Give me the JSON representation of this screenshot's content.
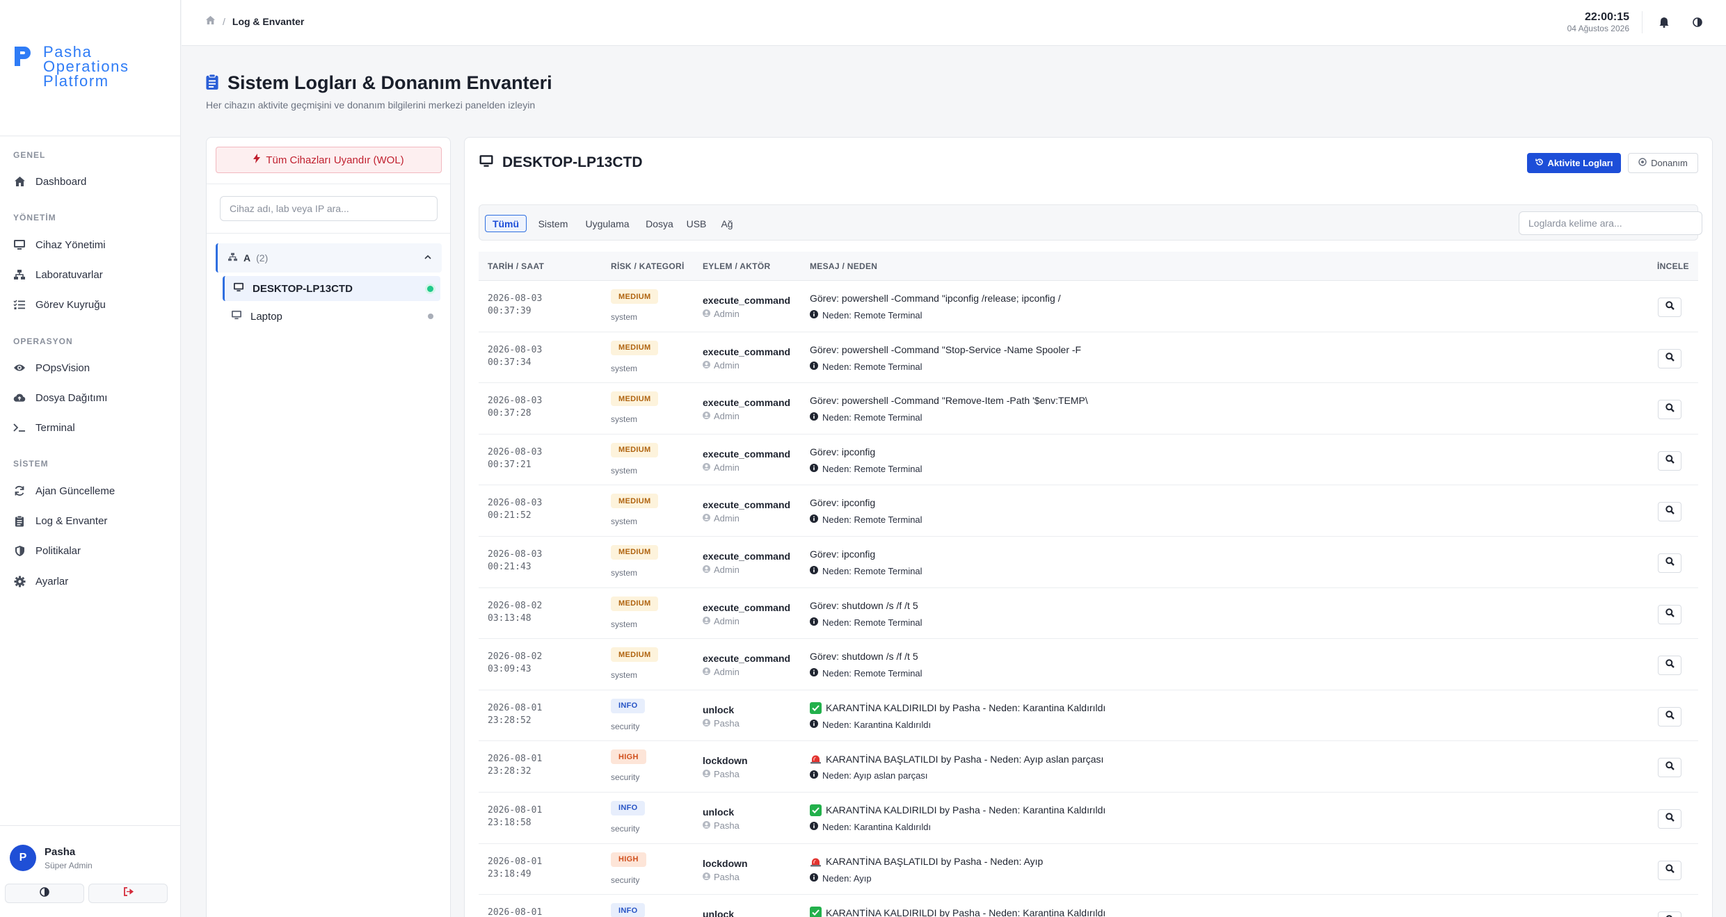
{
  "brand": {
    "line1": "Pasha",
    "line2": "Operations",
    "line3": "Platform"
  },
  "sidebar": {
    "sections": [
      {
        "label": "GENEL",
        "items": [
          {
            "label": "Dashboard",
            "icon": "home-icon"
          }
        ]
      },
      {
        "label": "YÖNETİM",
        "items": [
          {
            "label": "Cihaz Yönetimi",
            "icon": "monitor-icon"
          },
          {
            "label": "Laboratuvarlar",
            "icon": "network-icon"
          },
          {
            "label": "Görev Kuyruğu",
            "icon": "list-check-icon"
          }
        ]
      },
      {
        "label": "OPERASYON",
        "items": [
          {
            "label": "POpsVision",
            "icon": "eye-icon"
          },
          {
            "label": "Dosya Dağıtımı",
            "icon": "cloud-upload-icon"
          },
          {
            "label": "Terminal",
            "icon": "terminal-icon"
          }
        ]
      },
      {
        "label": "SİSTEM",
        "items": [
          {
            "label": "Ajan Güncelleme",
            "icon": "sync-icon"
          },
          {
            "label": "Log & Envanter",
            "icon": "clipboard-icon"
          },
          {
            "label": "Politikalar",
            "icon": "shield-icon"
          },
          {
            "label": "Ayarlar",
            "icon": "gear-icon"
          }
        ]
      }
    ],
    "user": {
      "initial": "P",
      "name": "Pasha",
      "role": "Süper Admin"
    }
  },
  "topbar": {
    "breadcrumb_current": "Log & Envanter",
    "breadcrumb_sep": "/",
    "time": "22:00:15",
    "date": "04 Ağustos 2026"
  },
  "page": {
    "title": "Sistem Logları & Donanım Envanteri",
    "subtitle": "Her cihazın aktivite geçmişini ve donanım bilgilerini merkezi panelden izleyin"
  },
  "devices": {
    "wol_label": "Tüm Cihazları Uyandır (WOL)",
    "search_placeholder": "Cihaz adı, lab veya IP ara...",
    "group": {
      "name": "A",
      "count": "(2)"
    },
    "items": [
      {
        "name": "DESKTOP-LP13CTD",
        "status": "online",
        "status_color": "#1fc98a"
      },
      {
        "name": "Laptop",
        "status": "offline",
        "status_color": "#a9aeb8"
      }
    ]
  },
  "logs": {
    "device_name": "DESKTOP-LP13CTD",
    "activity_button": "Aktivite Logları",
    "hardware_button": "Donanım",
    "tabs": [
      "Tümü",
      "Sistem",
      "Uygulama",
      "Dosya",
      "USB",
      "Ağ"
    ],
    "search_placeholder": "Loglarda kelime ara...",
    "columns": [
      "TARİH / SAAT",
      "RİSK / KATEGORİ",
      "EYLEM / AKTÖR",
      "MESAJ / NEDEN",
      "İNCELE"
    ],
    "rows": [
      {
        "date": "2026-08-03",
        "time": "00:37:39",
        "risk": "MEDIUM",
        "category": "system",
        "action": "execute_command",
        "actor": "Admin",
        "message": "Görev: powershell -Command \"ipconfig /release; ipconfig /",
        "reason": "Neden: Remote Terminal"
      },
      {
        "date": "2026-08-03",
        "time": "00:37:34",
        "risk": "MEDIUM",
        "category": "system",
        "action": "execute_command",
        "actor": "Admin",
        "message": "Görev: powershell -Command \"Stop-Service -Name Spooler -F",
        "reason": "Neden: Remote Terminal"
      },
      {
        "date": "2026-08-03",
        "time": "00:37:28",
        "risk": "MEDIUM",
        "category": "system",
        "action": "execute_command",
        "actor": "Admin",
        "message": "Görev: powershell -Command \"Remove-Item -Path '$env:TEMP\\",
        "reason": "Neden: Remote Terminal"
      },
      {
        "date": "2026-08-03",
        "time": "00:37:21",
        "risk": "MEDIUM",
        "category": "system",
        "action": "execute_command",
        "actor": "Admin",
        "message": "Görev: ipconfig",
        "reason": "Neden: Remote Terminal"
      },
      {
        "date": "2026-08-03",
        "time": "00:21:52",
        "risk": "MEDIUM",
        "category": "system",
        "action": "execute_command",
        "actor": "Admin",
        "message": "Görev: ipconfig",
        "reason": "Neden: Remote Terminal"
      },
      {
        "date": "2026-08-03",
        "time": "00:21:43",
        "risk": "MEDIUM",
        "category": "system",
        "action": "execute_command",
        "actor": "Admin",
        "message": "Görev: ipconfig",
        "reason": "Neden: Remote Terminal"
      },
      {
        "date": "2026-08-02",
        "time": "03:13:48",
        "risk": "MEDIUM",
        "category": "system",
        "action": "execute_command",
        "actor": "Admin",
        "message": "Görev: shutdown /s /f /t 5",
        "reason": "Neden: Remote Terminal"
      },
      {
        "date": "2026-08-02",
        "time": "03:09:43",
        "risk": "MEDIUM",
        "category": "system",
        "action": "execute_command",
        "actor": "Admin",
        "message": "Görev: shutdown /s /f /t 5",
        "reason": "Neden: Remote Terminal"
      },
      {
        "date": "2026-08-01",
        "time": "23:28:52",
        "risk": "INFO",
        "category": "security",
        "action": "unlock",
        "actor": "Pasha",
        "message": "KARANTİNA KALDIRILDI by Pasha - Neden: Karantina Kaldırıldı",
        "emoji": "check",
        "reason": "Neden: Karantina Kaldırıldı"
      },
      {
        "date": "2026-08-01",
        "time": "23:28:32",
        "risk": "HIGH",
        "category": "security",
        "action": "lockdown",
        "actor": "Pasha",
        "message": "KARANTİNA BAŞLATILDI by Pasha - Neden: Ayıp aslan parçası",
        "emoji": "siren",
        "reason": "Neden: Ayıp aslan parçası"
      },
      {
        "date": "2026-08-01",
        "time": "23:18:58",
        "risk": "INFO",
        "category": "security",
        "action": "unlock",
        "actor": "Pasha",
        "message": "KARANTİNA KALDIRILDI by Pasha - Neden: Karantina Kaldırıldı",
        "emoji": "check",
        "reason": "Neden: Karantina Kaldırıldı"
      },
      {
        "date": "2026-08-01",
        "time": "23:18:49",
        "risk": "HIGH",
        "category": "security",
        "action": "lockdown",
        "actor": "Pasha",
        "message": "KARANTİNA BAŞLATILDI by Pasha - Neden: Ayıp",
        "emoji": "siren",
        "reason": "Neden: Ayıp"
      },
      {
        "date": "2026-08-01",
        "time": "",
        "risk": "INFO",
        "category": "",
        "action": "unlock",
        "actor": "",
        "message": "KARANTİNA KALDIRILDI by Pasha - Neden: Karantina Kaldırıldı",
        "emoji": "check",
        "reason": ""
      }
    ]
  },
  "colors": {
    "accent": "#1d4ed8",
    "brand": "#2f7cf6",
    "danger": "#c0202f"
  }
}
